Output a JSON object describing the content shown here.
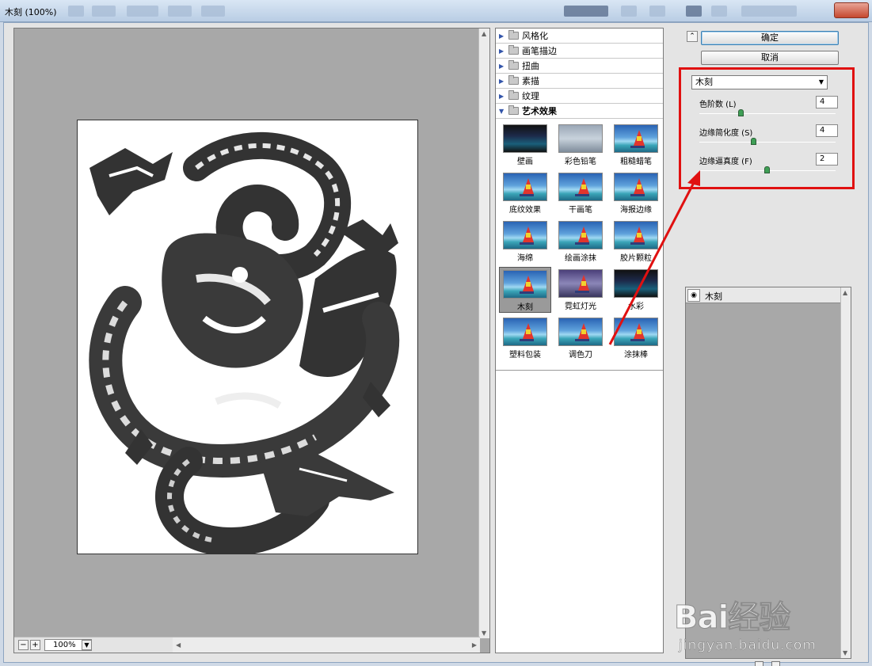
{
  "window": {
    "title": "木刻 (100%)"
  },
  "preview": {
    "zoom": "100%",
    "zoom_out": "−",
    "zoom_in": "+"
  },
  "gallery": {
    "categories": [
      {
        "label": "风格化",
        "expanded": false
      },
      {
        "label": "画笔描边",
        "expanded": false
      },
      {
        "label": "扭曲",
        "expanded": false
      },
      {
        "label": "素描",
        "expanded": false
      },
      {
        "label": "纹理",
        "expanded": false
      },
      {
        "label": "艺术效果",
        "expanded": true
      }
    ],
    "filters": [
      {
        "label": "壁画",
        "style": "dark"
      },
      {
        "label": "彩色铅笔",
        "style": "gray"
      },
      {
        "label": "粗糙蜡笔",
        "style": "normal"
      },
      {
        "label": "底纹效果",
        "style": "normal"
      },
      {
        "label": "干画笔",
        "style": "normal"
      },
      {
        "label": "海报边缘",
        "style": "normal"
      },
      {
        "label": "海绵",
        "style": "normal"
      },
      {
        "label": "绘画涂抹",
        "style": "normal"
      },
      {
        "label": "胶片颗粒",
        "style": "normal"
      },
      {
        "label": "木刻",
        "style": "normal",
        "selected": true
      },
      {
        "label": "霓虹灯光",
        "style": "neon"
      },
      {
        "label": "水彩",
        "style": "dark"
      },
      {
        "label": "塑料包装",
        "style": "normal"
      },
      {
        "label": "调色刀",
        "style": "normal"
      },
      {
        "label": "涂抹棒",
        "style": "normal"
      }
    ]
  },
  "options": {
    "ok": "确定",
    "cancel": "取消",
    "filter_select": "木刻",
    "params": [
      {
        "label": "色阶数 (L)",
        "value": "4",
        "level": 0.31
      },
      {
        "label": "边缘简化度 (S)",
        "value": "4",
        "level": 0.4
      },
      {
        "label": "边缘逼真度 (F)",
        "value": "2",
        "level": 0.5
      }
    ],
    "highlight_color": "#e01010"
  },
  "layers": {
    "items": [
      {
        "name": "木刻",
        "visible": true
      }
    ]
  },
  "watermark": {
    "brand": "Bai经验",
    "url": "jingyan.baidu.com"
  }
}
